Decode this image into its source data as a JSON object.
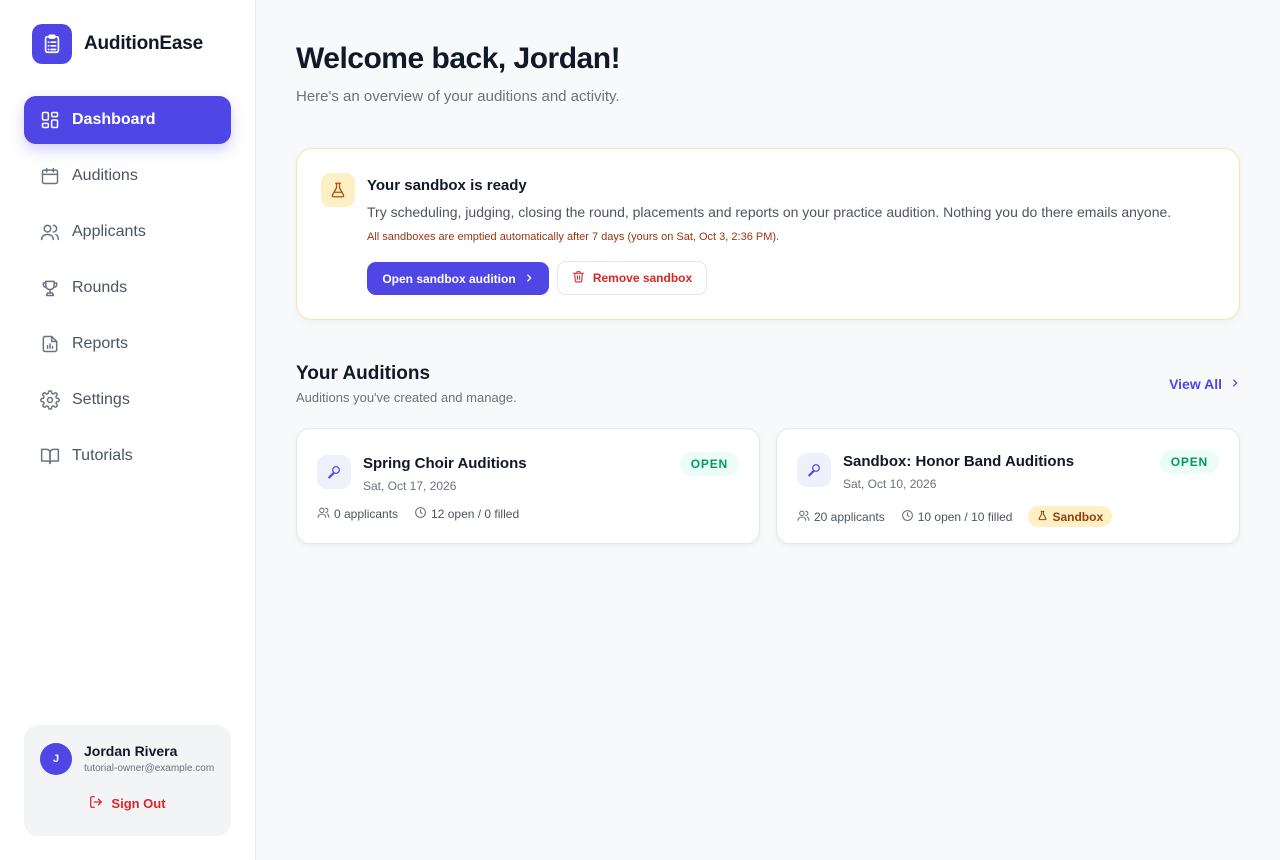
{
  "app": {
    "name": "AuditionEase"
  },
  "sidebar": {
    "items": [
      {
        "label": "Dashboard",
        "icon": "dashboard-icon",
        "active": true
      },
      {
        "label": "Auditions",
        "icon": "calendar-icon"
      },
      {
        "label": "Applicants",
        "icon": "users-icon"
      },
      {
        "label": "Rounds",
        "icon": "trophy-icon"
      },
      {
        "label": "Reports",
        "icon": "report-icon"
      },
      {
        "label": "Settings",
        "icon": "gear-icon"
      },
      {
        "label": "Tutorials",
        "icon": "book-icon"
      }
    ]
  },
  "user": {
    "initial": "J",
    "name": "Jordan Rivera",
    "email": "tutorial-owner@example.com",
    "sign_out_label": "Sign Out"
  },
  "header": {
    "title": "Welcome back, Jordan!",
    "subtitle": "Here's an overview of your auditions and activity."
  },
  "sandbox": {
    "title": "Your sandbox is ready",
    "description": "Try scheduling, judging, closing the round, placements and reports on your practice audition. Nothing you do there emails anyone.",
    "note": "All sandboxes are emptied automatically after 7 days (yours on Sat, Oct 3, 2:36 PM).",
    "open_label": "Open sandbox audition",
    "remove_label": "Remove sandbox"
  },
  "auditions": {
    "title": "Your Auditions",
    "subtitle": "Auditions you've created and manage.",
    "view_all_label": "View All",
    "cards": [
      {
        "name": "Spring Choir Auditions",
        "date": "Sat, Oct 17, 2026",
        "status": "OPEN",
        "applicants": "0 applicants",
        "slots": "12 open / 0 filled"
      },
      {
        "name": "Sandbox: Honor Band Auditions",
        "date": "Sat, Oct 10, 2026",
        "status": "OPEN",
        "applicants": "20 applicants",
        "slots": "10 open / 10 filled",
        "tag": "Sandbox"
      }
    ]
  },
  "colors": {
    "accent": "#4f46e5",
    "danger": "#dc2626",
    "open_badge": "#059669",
    "sandbox_bg": "#fdf0c4"
  }
}
